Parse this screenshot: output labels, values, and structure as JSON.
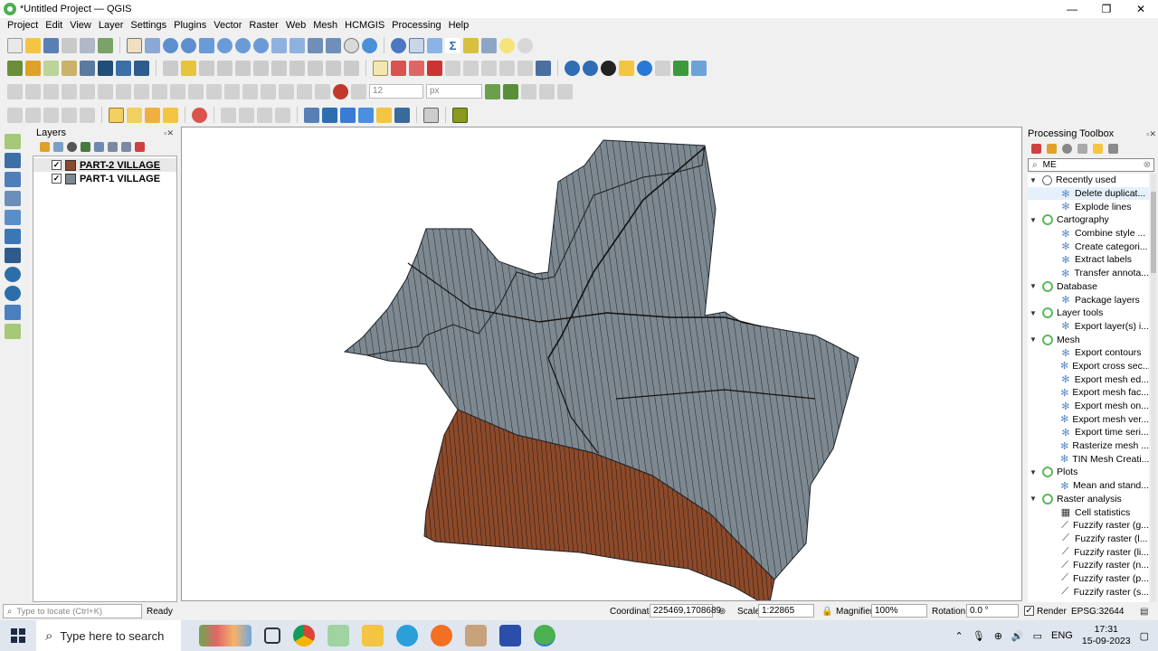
{
  "window": {
    "title": "*Untitled Project — QGIS",
    "minimize": "—",
    "maximize": "❐",
    "close": "✕"
  },
  "menu": [
    "Project",
    "Edit",
    "View",
    "Layer",
    "Settings",
    "Plugins",
    "Vector",
    "Raster",
    "Web",
    "Mesh",
    "HCMGIS",
    "Processing",
    "Help"
  ],
  "digitize": {
    "font_size": "12",
    "unit": "px"
  },
  "layers_panel": {
    "title": "Layers",
    "items": [
      {
        "label": "PART-2 VILLAGE",
        "color": "#8b4a2b",
        "checked": "✓"
      },
      {
        "label": "PART-1 VILLAGE",
        "color": "#7d8890",
        "checked": "✓"
      }
    ]
  },
  "toolbox": {
    "title": "Processing Toolbox",
    "search_value": "ME",
    "groups": [
      {
        "label": "Recently used",
        "kind": "clock",
        "items": [
          "Delete duplicat...",
          "Explode lines"
        ]
      },
      {
        "label": "Cartography",
        "kind": "q",
        "items": [
          "Combine style ...",
          "Create categori...",
          "Extract labels",
          "Transfer annota..."
        ]
      },
      {
        "label": "Database",
        "kind": "q",
        "items": [
          "Package layers"
        ]
      },
      {
        "label": "Layer tools",
        "kind": "q",
        "items": [
          "Export layer(s) i..."
        ]
      },
      {
        "label": "Mesh",
        "kind": "q",
        "items": [
          "Export contours",
          "Export cross sec...",
          "Export mesh ed...",
          "Export mesh fac...",
          "Export mesh on...",
          "Export mesh ver...",
          "Export time seri...",
          "Rasterize mesh ...",
          "TIN Mesh Creati..."
        ]
      },
      {
        "label": "Plots",
        "kind": "q",
        "items": [
          "Mean and stand..."
        ]
      },
      {
        "label": "Raster analysis",
        "kind": "q",
        "items": [
          "Cell statistics",
          "Fuzzify raster (g...",
          "Fuzzify raster (l...",
          "Fuzzify raster (li...",
          "Fuzzify raster (n...",
          "Fuzzify raster (p...",
          "Fuzzify raster (s..."
        ]
      }
    ]
  },
  "status": {
    "locate_placeholder": "Type to locate (Ctrl+K)",
    "ready": "Ready",
    "coordinate_label": "Coordinate",
    "coordinate": "225469,1708689",
    "scale_label": "Scale",
    "scale": "1:22865",
    "magnifier_label": "Magnifier",
    "magnifier": "100%",
    "rotation_label": "Rotation",
    "rotation": "0.0 °",
    "render_label": "Render",
    "epsg": "EPSG:32644"
  },
  "taskbar": {
    "search_placeholder": "Type here to search",
    "lang": "ENG",
    "time": "17:31",
    "date": "15-09-2023"
  }
}
